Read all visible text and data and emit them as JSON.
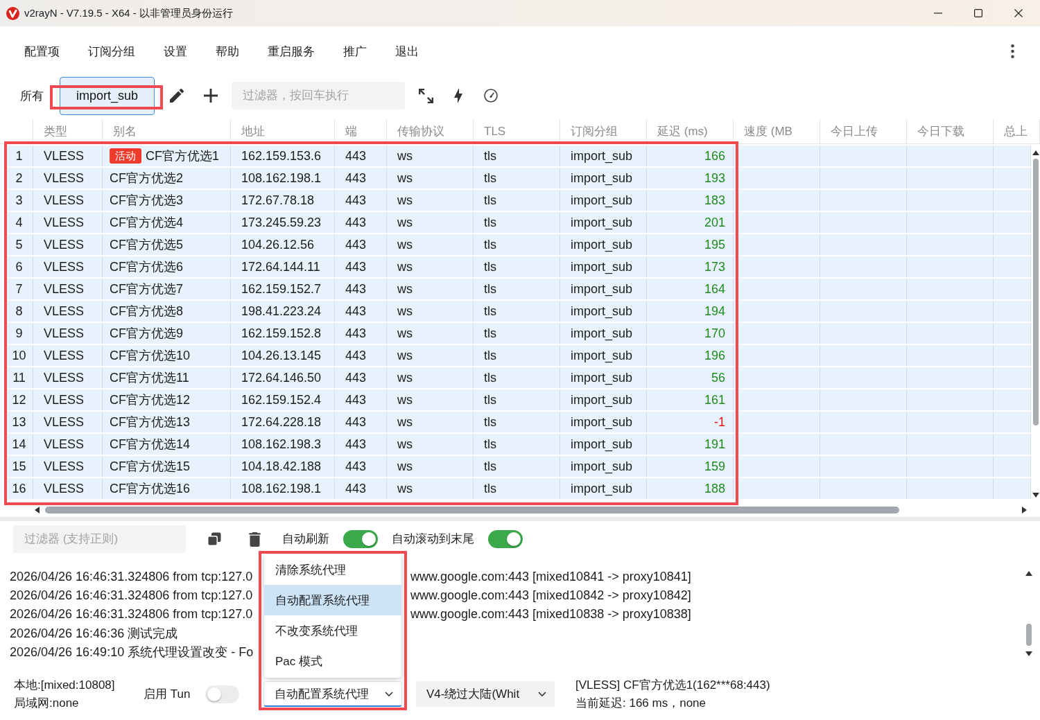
{
  "window": {
    "title": "v2rayN - V7.19.5 - X64 - 以非管理员身份运行"
  },
  "menu": [
    "配置项",
    "订阅分组",
    "设置",
    "帮助",
    "重启服务",
    "推广",
    "退出"
  ],
  "groups": {
    "tabs": [
      {
        "label": "所有",
        "selected": false,
        "highlighted": false
      },
      {
        "label": "import_sub",
        "selected": true,
        "highlighted": true
      }
    ],
    "filter": {
      "placeholder": "过滤器，按回车执行"
    }
  },
  "table": {
    "highlighted": true,
    "columns": [
      "类型",
      "别名",
      "地址",
      "端",
      "传输协议",
      "TLS",
      "订阅分组",
      "延迟 (ms)",
      "速度 (MB",
      "今日上传",
      "今日下载",
      "总上"
    ],
    "rows": [
      {
        "no": "1",
        "type": "VLESS",
        "badge": "活动",
        "name": "CF官方优选1",
        "address": "162.159.153.6",
        "port": "443",
        "transport": "ws",
        "tls": "tls",
        "group": "import_sub",
        "delay": {
          "text": "166",
          "color": "#1c8c1c"
        }
      },
      {
        "no": "2",
        "type": "VLESS",
        "name": "CF官方优选2",
        "address": "108.162.198.1",
        "port": "443",
        "transport": "ws",
        "tls": "tls",
        "group": "import_sub",
        "delay": {
          "text": "193",
          "color": "#1c8c1c"
        }
      },
      {
        "no": "3",
        "type": "VLESS",
        "name": "CF官方优选3",
        "address": "172.67.78.18",
        "port": "443",
        "transport": "ws",
        "tls": "tls",
        "group": "import_sub",
        "delay": {
          "text": "183",
          "color": "#1c8c1c"
        }
      },
      {
        "no": "4",
        "type": "VLESS",
        "name": "CF官方优选4",
        "address": "173.245.59.23",
        "port": "443",
        "transport": "ws",
        "tls": "tls",
        "group": "import_sub",
        "delay": {
          "text": "201",
          "color": "#1c8c1c"
        }
      },
      {
        "no": "5",
        "type": "VLESS",
        "name": "CF官方优选5",
        "address": "104.26.12.56",
        "port": "443",
        "transport": "ws",
        "tls": "tls",
        "group": "import_sub",
        "delay": {
          "text": "195",
          "color": "#1c8c1c"
        }
      },
      {
        "no": "6",
        "type": "VLESS",
        "name": "CF官方优选6",
        "address": "172.64.144.11",
        "port": "443",
        "transport": "ws",
        "tls": "tls",
        "group": "import_sub",
        "delay": {
          "text": "173",
          "color": "#1c8c1c"
        }
      },
      {
        "no": "7",
        "type": "VLESS",
        "name": "CF官方优选7",
        "address": "162.159.152.7",
        "port": "443",
        "transport": "ws",
        "tls": "tls",
        "group": "import_sub",
        "delay": {
          "text": "164",
          "color": "#1c8c1c"
        }
      },
      {
        "no": "8",
        "type": "VLESS",
        "name": "CF官方优选8",
        "address": "198.41.223.24",
        "port": "443",
        "transport": "ws",
        "tls": "tls",
        "group": "import_sub",
        "delay": {
          "text": "194",
          "color": "#1c8c1c"
        }
      },
      {
        "no": "9",
        "type": "VLESS",
        "name": "CF官方优选9",
        "address": "162.159.152.8",
        "port": "443",
        "transport": "ws",
        "tls": "tls",
        "group": "import_sub",
        "delay": {
          "text": "170",
          "color": "#1c8c1c"
        }
      },
      {
        "no": "10",
        "type": "VLESS",
        "name": "CF官方优选10",
        "address": "104.26.13.145",
        "port": "443",
        "transport": "ws",
        "tls": "tls",
        "group": "import_sub",
        "delay": {
          "text": "196",
          "color": "#1c8c1c"
        }
      },
      {
        "no": "11",
        "type": "VLESS",
        "name": "CF官方优选11",
        "address": "172.64.146.50",
        "port": "443",
        "transport": "ws",
        "tls": "tls",
        "group": "import_sub",
        "delay": {
          "text": "56",
          "color": "#1c8c1c"
        }
      },
      {
        "no": "12",
        "type": "VLESS",
        "name": "CF官方优选12",
        "address": "162.159.152.4",
        "port": "443",
        "transport": "ws",
        "tls": "tls",
        "group": "import_sub",
        "delay": {
          "text": "161",
          "color": "#1c8c1c"
        }
      },
      {
        "no": "13",
        "type": "VLESS",
        "name": "CF官方优选13",
        "address": "172.64.228.18",
        "port": "443",
        "transport": "ws",
        "tls": "tls",
        "group": "import_sub",
        "delay": {
          "text": "-1",
          "color": "#e81010"
        }
      },
      {
        "no": "14",
        "type": "VLESS",
        "name": "CF官方优选14",
        "address": "108.162.198.3",
        "port": "443",
        "transport": "ws",
        "tls": "tls",
        "group": "import_sub",
        "delay": {
          "text": "191",
          "color": "#1c8c1c"
        }
      },
      {
        "no": "15",
        "type": "VLESS",
        "name": "CF官方优选15",
        "address": "104.18.42.188",
        "port": "443",
        "transport": "ws",
        "tls": "tls",
        "group": "import_sub",
        "delay": {
          "text": "159",
          "color": "#1c8c1c"
        }
      },
      {
        "no": "16",
        "type": "VLESS",
        "name": "CF官方优选16",
        "address": "108.162.198.1",
        "port": "443",
        "transport": "ws",
        "tls": "tls",
        "group": "import_sub",
        "delay": {
          "text": "188",
          "color": "#1c8c1c"
        }
      }
    ]
  },
  "log": {
    "filter": {
      "placeholder": "过滤器 (支持正则)"
    },
    "toggles": [
      {
        "label": "自动刷新",
        "on": true
      },
      {
        "label": "自动滚动到末尾",
        "on": true
      }
    ],
    "lines": [
      {
        "start": "2026/04/26 16:46:31.324806 from tcp:127.0",
        "end": "www.google.com:443 [mixed10841 -> proxy10841]"
      },
      {
        "start": "2026/04/26 16:46:31.324806 from tcp:127.0",
        "end": "www.google.com:443 [mixed10842 -> proxy10842]"
      },
      {
        "start": "2026/04/26 16:46:31.324806 from tcp:127.0",
        "end": "www.google.com:443 [mixed10838 -> proxy10838]"
      },
      {
        "start": "2026/04/26 16:46:36 测试完成"
      },
      {
        "start": "2026/04/26 16:49:10 系统代理设置改变 - Fo"
      }
    ]
  },
  "proxy_menu": {
    "highlighted": true,
    "items": [
      {
        "label": "清除系统代理",
        "selected": false
      },
      {
        "label": "自动配置系统代理",
        "selected": true
      },
      {
        "label": "不改变系统代理",
        "selected": false
      },
      {
        "label": "Pac 模式",
        "selected": false
      }
    ]
  },
  "status_bar": {
    "local": "本地:[mixed:10808]",
    "lan": "局域网:none",
    "tun": {
      "label": "启用 Tun",
      "on": false
    },
    "proxy_mode": "自动配置系统代理",
    "routing": "V4-绕过大陆(Whit",
    "server": "[VLESS] CF官方优选1(162***68:443)",
    "latency": "当前延迟: 166 ms，none"
  }
}
